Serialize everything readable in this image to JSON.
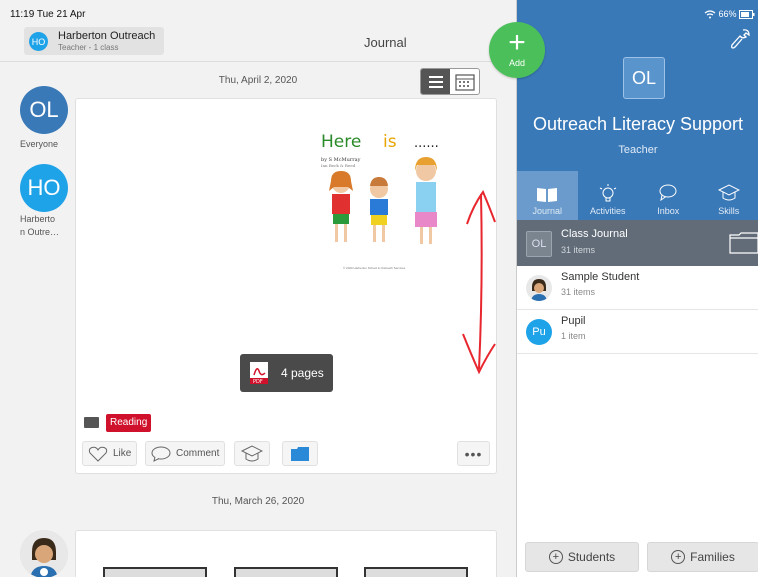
{
  "status": {
    "time": "11:19  Tue 21 Apr",
    "battery": "66%"
  },
  "account": {
    "initials": "HO",
    "name": "Harberton Outreach",
    "subtitle": "Teacher - 1 class"
  },
  "page": {
    "title": "Journal"
  },
  "fab": {
    "label": "Add",
    "symbol": "+"
  },
  "sidebar": [
    {
      "initials": "OL",
      "label": "Everyone",
      "color": "#3a79b8"
    },
    {
      "initials": "HO",
      "label_lines": [
        "Harberto",
        "n Outre…"
      ],
      "color": "#1fa3e8"
    }
  ],
  "feed": {
    "date1": "Thu, April 2, 2020",
    "date2": "Thu, March 26, 2020",
    "post": {
      "doc_title_parts": [
        "Here",
        "is",
        "......"
      ],
      "doc_byline1": "by S McMurray",
      "doc_byline2": "Ian Beck & Reed",
      "doc_footer": "© 2020 Harberton School & Outreach Services",
      "pages_label": "4 pages",
      "pdf_label": "PDF",
      "tag": "Reading",
      "like": "Like",
      "comment": "Comment",
      "more": "•••"
    }
  },
  "panel": {
    "initials": "OL",
    "title": "Outreach Literacy Support",
    "role": "Teacher",
    "tabs": [
      {
        "label": "Journal",
        "icon": "book-icon"
      },
      {
        "label": "Activities",
        "icon": "lightbulb-icon"
      },
      {
        "label": "Inbox",
        "icon": "chat-icon"
      },
      {
        "label": "Skills",
        "icon": "mortarboard-icon"
      }
    ],
    "selected": {
      "initials": "OL",
      "name": "Class Journal",
      "count": "31 items"
    },
    "students": [
      {
        "initials": "",
        "name": "Sample Student",
        "count": "31 items"
      },
      {
        "initials": "Pu",
        "name": "Pupil",
        "count": "1 item"
      }
    ],
    "buttons": {
      "students": "Students",
      "families": "Families"
    }
  },
  "colors": {
    "brand_blue": "#3a79b8",
    "fab_green": "#4bc05a",
    "tag_red": "#d0112b",
    "annotation_red": "#e8262e"
  }
}
